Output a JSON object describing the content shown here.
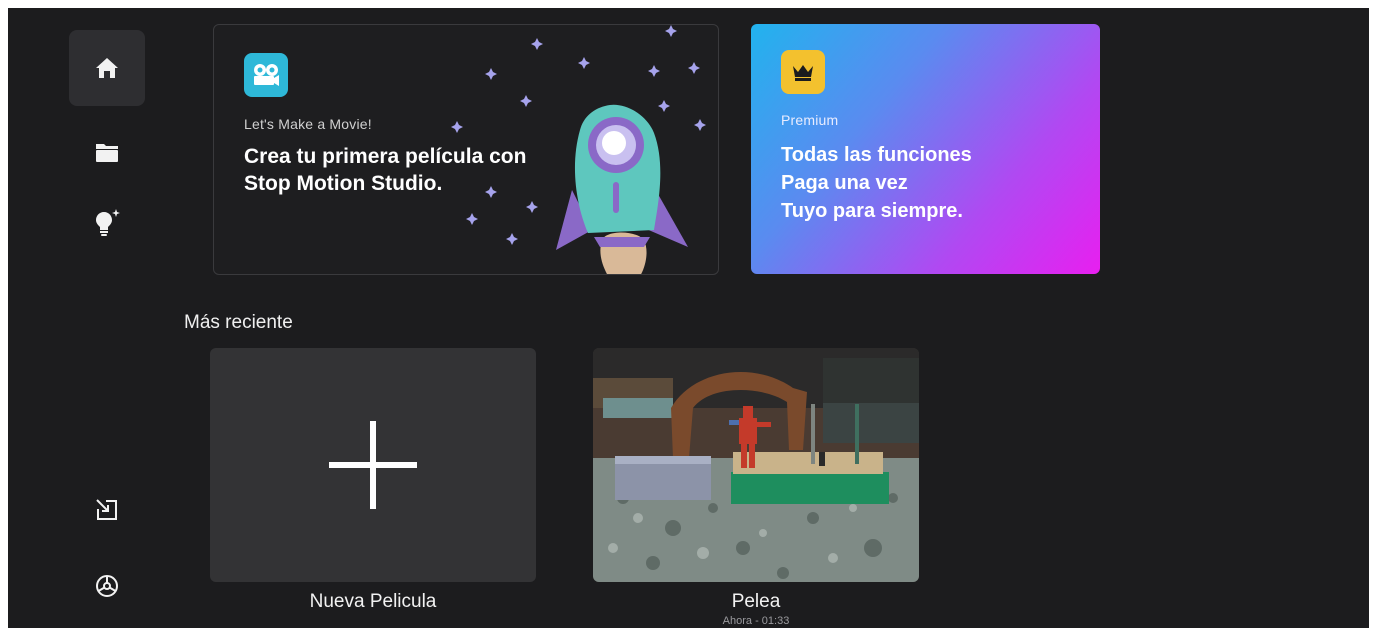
{
  "colors": {
    "background": "#1c1c1e",
    "accent_teal": "#2eb8d8",
    "premium_gold": "#f3c12e"
  },
  "sidebar": {
    "items": [
      {
        "name": "home",
        "icon": "home-icon",
        "active": true
      },
      {
        "name": "projects",
        "icon": "folder-icon",
        "active": false
      },
      {
        "name": "tips",
        "icon": "lightbulb-sparkle-icon",
        "active": false
      }
    ],
    "bottom_items": [
      {
        "name": "import",
        "icon": "import-icon"
      },
      {
        "name": "settings",
        "icon": "gear-icon"
      }
    ]
  },
  "promo": {
    "icon": "film-camera-icon",
    "eyebrow": "Let's Make a Movie!",
    "title_line1": "Crea tu primera película con",
    "title_line2": "Stop Motion Studio.",
    "illustration": "rocket-illustration"
  },
  "premium": {
    "icon": "crown-icon",
    "eyebrow": "Premium",
    "line1": "Todas las funciones",
    "line2": "Paga una vez",
    "line3": "Tuyo para siempre."
  },
  "recent": {
    "title": "Más reciente",
    "new_movie": {
      "icon": "plus-icon",
      "label": "Nueva Pelicula"
    },
    "projects": [
      {
        "title": "Pelea",
        "meta": "Ahora - 01:33",
        "thumbnail": "toy-figure-photo"
      }
    ]
  }
}
